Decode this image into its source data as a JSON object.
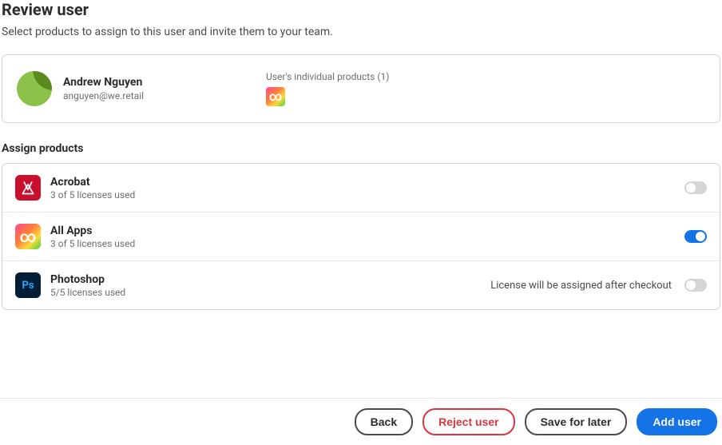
{
  "header": {
    "title": "Review user",
    "subtitle": "Select products to assign to this user and invite them to your team."
  },
  "user": {
    "name": "Andrew Nguyen",
    "email": "anguyen@we.retail",
    "products_label": "User's individual products (1)"
  },
  "assign": {
    "heading": "Assign products",
    "items": [
      {
        "name": "Acrobat",
        "sub": "3 of 5 licenses used",
        "note": "",
        "enabled": false
      },
      {
        "name": "All Apps",
        "sub": "3 of 5 licenses used",
        "note": "",
        "enabled": true
      },
      {
        "name": "Photoshop",
        "sub": "5/5 licenses used",
        "note": "License will be assigned after checkout",
        "enabled": false
      }
    ]
  },
  "footer": {
    "back": "Back",
    "reject": "Reject user",
    "save": "Save for later",
    "add": "Add user"
  }
}
